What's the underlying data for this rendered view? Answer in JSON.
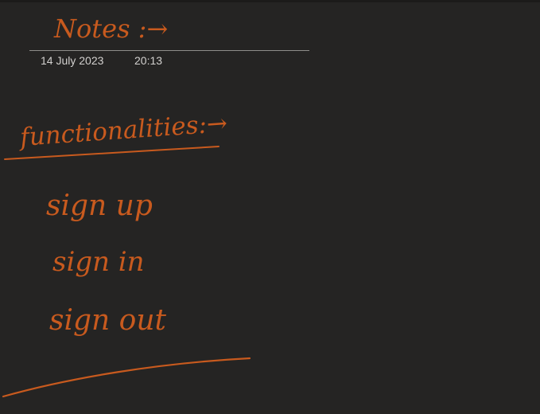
{
  "note": {
    "title": "Notes :→",
    "date": "14 July 2023",
    "time": "20:13"
  },
  "ink": {
    "color": "#c85a1e",
    "strokes": [
      {
        "name": "heading-functionalities",
        "text": "functionalities:→"
      },
      {
        "name": "item-sign-up",
        "text": "sign up"
      },
      {
        "name": "item-sign-in",
        "text": "sign in"
      },
      {
        "name": "item-sign-out",
        "text": "sign out"
      }
    ]
  },
  "colors": {
    "canvas": "#252423",
    "rule": "#8f8d8a",
    "meta_text": "#d2d0ce"
  }
}
